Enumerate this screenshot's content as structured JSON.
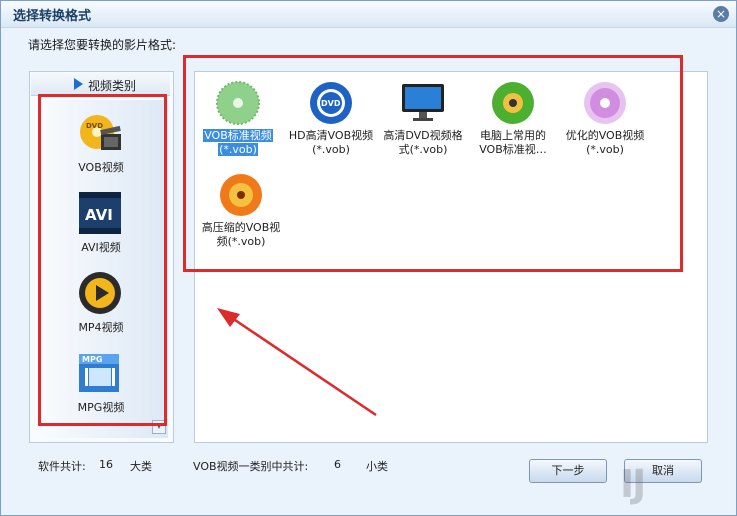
{
  "window": {
    "title": "选择转换格式"
  },
  "instruction": "请选择您要转换的影片格式:",
  "category_header": "视频类别",
  "categories": [
    {
      "label": "VOB视频",
      "icon": "vob-film-icon"
    },
    {
      "label": "AVI视频",
      "icon": "avi-film-icon"
    },
    {
      "label": "MP4视频",
      "icon": "mp4-play-icon"
    },
    {
      "label": "MPG视频",
      "icon": "mpg-film-icon"
    }
  ],
  "formats": [
    {
      "label_line1": "VOB标准视频",
      "label_line2": "(*.vob)",
      "icon": "disc-icon",
      "selected": true
    },
    {
      "label_line1": "HD高清VOB视频",
      "label_line2": "(*.vob)",
      "icon": "dvd-disc-icon",
      "selected": false
    },
    {
      "label_line1": "高清DVD视频格",
      "label_line2": "式(*.vob)",
      "icon": "monitor-icon",
      "selected": false
    },
    {
      "label_line1": "电脑上常用的",
      "label_line2": "VOB标准视…",
      "icon": "green-disc-icon",
      "selected": false
    },
    {
      "label_line1": "优化的VOB视频",
      "label_line2": "(*.vob)",
      "icon": "purple-disc-icon",
      "selected": false
    },
    {
      "label_line1": "高压缩的VOB视",
      "label_line2": "频(*.vob)",
      "icon": "orange-disc-icon",
      "selected": false
    }
  ],
  "status": {
    "total_label": "软件共计:",
    "total_count": "16",
    "total_unit": "大类",
    "category_label": "VOB视频一类别中共计:",
    "category_count": "6",
    "category_unit": "小类"
  },
  "buttons": {
    "next": "下一步",
    "cancel": "取消"
  },
  "colors": {
    "annotation": "#dd2a2a",
    "selection": "#3b8de0"
  }
}
